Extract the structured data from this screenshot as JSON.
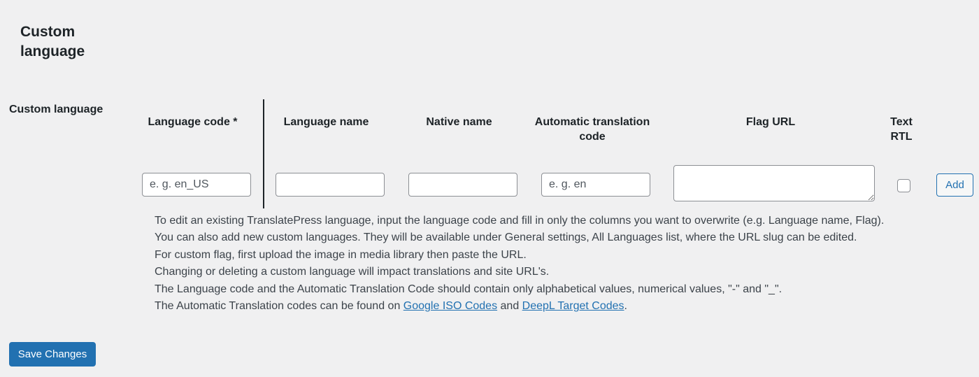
{
  "section": {
    "title": "Custom language"
  },
  "row": {
    "label": "Custom language"
  },
  "columns": {
    "language_code": "Language code *",
    "language_name": "Language name",
    "native_name": "Native name",
    "auto_translation_code_line1": "Automatic translation",
    "auto_translation_code_line2": "code",
    "flag_url": "Flag URL",
    "text_rtl_line1": "Text",
    "text_rtl_line2": "RTL"
  },
  "inputs": {
    "language_code": {
      "value": "",
      "placeholder": "e. g. en_US"
    },
    "language_name": {
      "value": "",
      "placeholder": ""
    },
    "native_name": {
      "value": "",
      "placeholder": ""
    },
    "auto_translation_code": {
      "value": "",
      "placeholder": "e. g. en"
    },
    "flag_url": {
      "value": ""
    },
    "text_rtl_checked": false
  },
  "buttons": {
    "add": "Add",
    "save": "Save Changes"
  },
  "help": {
    "line1": "To edit an existing TranslatePress language, input the language code and fill in only the columns you want to overwrite (e.g. Language name, Flag).",
    "line2": "You can also add new custom languages. They will be available under General settings, All Languages list, where the URL slug can be edited.",
    "line3": "For custom flag, first upload the image in media library then paste the URL.",
    "line4": "Changing or deleting a custom language will impact translations and site URL's.",
    "line5": "The Language code and the Automatic Translation Code should contain only alphabetical values, numerical values, \"-\" and \"_\".",
    "line6_prefix": "The Automatic Translation codes can be found on ",
    "link_google": "Google ISO Codes",
    "line6_and": " and ",
    "link_deepl": "DeepL Target Codes",
    "line6_suffix": "."
  },
  "colors": {
    "background": "#f0f0f1",
    "primary": "#2271b1",
    "text": "#1d2327",
    "help_text": "#3c434a",
    "input_border": "#8c8f94"
  }
}
